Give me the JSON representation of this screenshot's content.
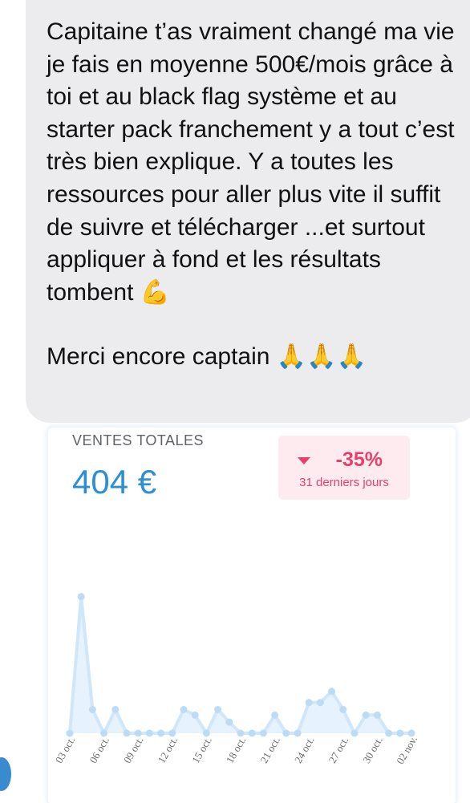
{
  "message": {
    "paragraph": "Capitaine t’as vraiment changé ma vie je fais en moyenne 500€/mois grâce à toi et au black flag système et au starter pack franchement y a tout c’est très bien explique. Y a toutes les ressources pour aller plus vite il suffit de suivre et télécharger ...et surtout appliquer à fond et les résultats tombent",
    "paragraph_emoji": "💪",
    "closing": "Merci encore captain",
    "closing_emoji": "🙏🙏🙏"
  },
  "card": {
    "title": "VENTES TOTALES",
    "total": "404 €",
    "change": "-35%",
    "change_period": "31 derniers jours"
  },
  "colors": {
    "accent": "#2b8fd6",
    "negative": "#e5406b",
    "badge_bg": "#fdebef",
    "line": "#cfe6fb",
    "area": "#e6f2fd",
    "point": "#bcdcf6"
  },
  "chart_data": {
    "type": "area",
    "x_tick_labels": [
      "03 oct.",
      "06 oct.",
      "09 oct.",
      "12 oct.",
      "15 oct.",
      "18 oct.",
      "21 oct.",
      "24 oct.",
      "27 oct.",
      "30 oct.",
      "02 nov."
    ],
    "x": [
      "03 oct.",
      "04 oct.",
      "05 oct.",
      "06 oct.",
      "07 oct.",
      "08 oct.",
      "09 oct.",
      "10 oct.",
      "11 oct.",
      "12 oct.",
      "13 oct.",
      "14 oct.",
      "15 oct.",
      "16 oct.",
      "17 oct.",
      "18 oct.",
      "19 oct.",
      "20 oct.",
      "21 oct.",
      "22 oct.",
      "23 oct.",
      "24 oct.",
      "25 oct.",
      "26 oct.",
      "27 oct.",
      "28 oct.",
      "29 oct.",
      "30 oct.",
      "31 oct.",
      "01 nov.",
      "02 nov."
    ],
    "values": [
      0,
      98,
      17,
      0,
      17,
      0,
      0,
      0,
      0,
      0,
      17,
      13,
      0,
      17,
      8,
      0,
      0,
      0,
      13,
      0,
      0,
      22,
      22,
      30,
      17,
      0,
      13,
      13,
      0,
      0,
      0
    ],
    "ylim": [
      0,
      110
    ],
    "grid": false,
    "legend": "none"
  }
}
